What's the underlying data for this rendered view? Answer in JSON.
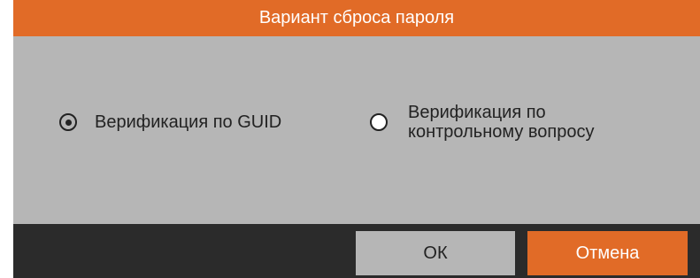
{
  "dialog": {
    "title": "Вариант сброса пароля",
    "options": [
      {
        "label": "Верификация по GUID",
        "selected": true
      },
      {
        "label": "Верификация по контрольному вопросу",
        "selected": false
      }
    ],
    "ok_label": "ОК",
    "cancel_label": "Отмена"
  },
  "colors": {
    "accent": "#e16b27",
    "content_bg": "#b6b6b6",
    "footer_bg": "#2b2b2b"
  }
}
